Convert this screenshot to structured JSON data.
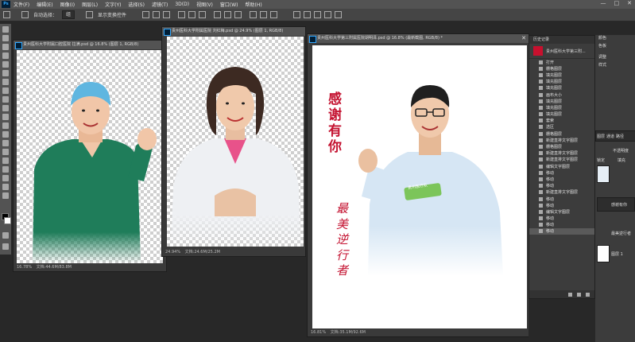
{
  "menubar": {
    "app_icon": "Ps",
    "items": [
      "文件(F)",
      "编辑(E)",
      "图像(I)",
      "图层(L)",
      "文字(Y)",
      "选择(S)",
      "滤镜(T)",
      "3D(D)",
      "视图(V)",
      "窗口(W)",
      "帮助(H)"
    ],
    "window_controls": [
      "—",
      "□",
      "✕"
    ]
  },
  "options_bar": {
    "auto_select_label": "自动选择：",
    "auto_select_value": "组",
    "transform_label": "显示变换控件"
  },
  "doc1": {
    "title": "贵州医科大学附属口腔医院 拉满.psd @ 16.8% (图层 1, RGB/8)",
    "zoom": "16.78%",
    "status": "文档:44.6M/83.8M"
  },
  "doc2": {
    "title": "贵州医科大学附属医院 刘红梅.psd @ 24.9% (图层 1, RGB/8)",
    "zoom": "24.94%",
    "status": "文档:24.6M/25.2M"
  },
  "doc3": {
    "title": "贵州医科大学第三附属医院胡明泽.psd @ 16.8% (最新截图, RGB/8) *",
    "zoom": "16.81%",
    "status": "文档:35.1M/92.6M",
    "headline": [
      "感",
      "谢",
      "有",
      "你"
    ],
    "subline": [
      "最",
      "美",
      "逆",
      "行",
      "者"
    ],
    "badge": "贵州医疗队"
  },
  "history": {
    "panel_title": "历史记录",
    "snapshot_name": "贵州医科大学第三附...",
    "items": [
      "打开",
      "栅格图层",
      "填充图层",
      "填充图层",
      "填充图层",
      "画布大小",
      "填充图层",
      "填充图层",
      "填充图层",
      "套索",
      "选区",
      "栅格图层",
      "新建直排文字图层",
      "栅格图层",
      "新建直排文字图层",
      "新建直排文字图层",
      "编辑文字图层",
      "移动",
      "移动",
      "移动",
      "新建直排文字图层",
      "移动",
      "移动",
      "编辑文字图层",
      "移动",
      "移动",
      "移动"
    ],
    "active_index": 26
  },
  "side": {
    "labels": [
      "颜色",
      "色板",
      "调整",
      "样式",
      "图层",
      "通道",
      "路径",
      "不透明度",
      "锁定",
      "填充",
      "感谢有你",
      "最美逆行者",
      "图层 1"
    ]
  }
}
